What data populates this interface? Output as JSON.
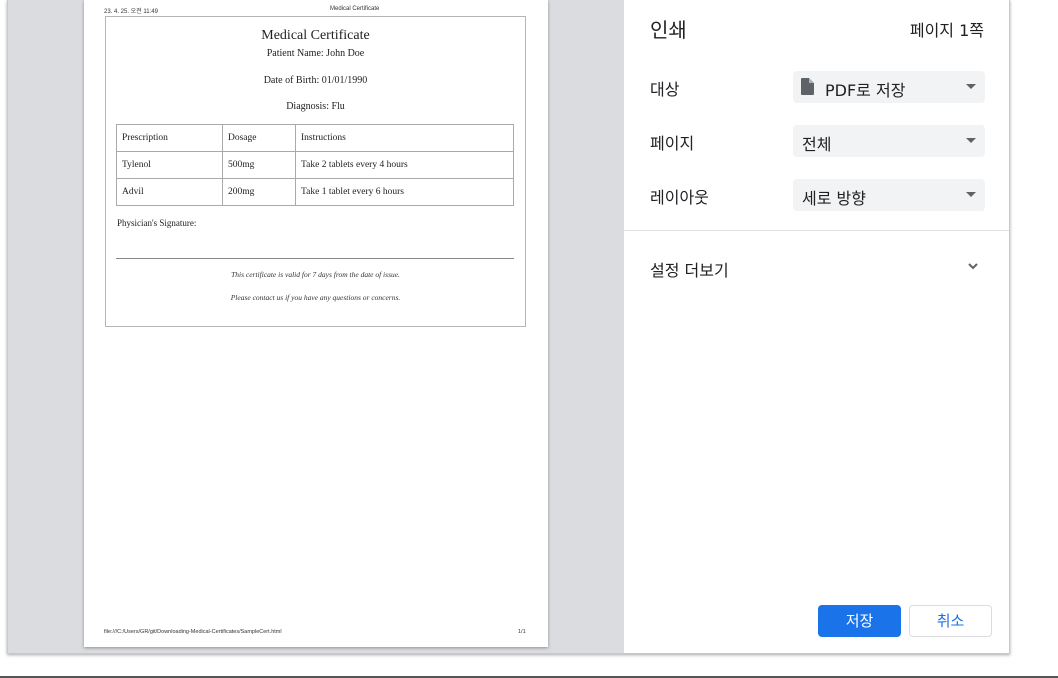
{
  "preview": {
    "header_datetime": "23. 4. 25. 오전 11:49",
    "header_title": "Medical Certificate",
    "certificate": {
      "title": "Medical Certificate",
      "patient": "Patient Name: John Doe",
      "dob": "Date of Birth: 01/01/1990",
      "diagnosis": "Diagnosis: Flu",
      "table": {
        "headers": [
          "Prescription",
          "Dosage",
          "Instructions"
        ],
        "rows": [
          [
            "Tylenol",
            "500mg",
            "Take 2 tablets every 4 hours"
          ],
          [
            "Advil",
            "200mg",
            "Take 1 tablet every 6 hours"
          ]
        ]
      },
      "signature_label": "Physician's Signature:",
      "note1": "This certificate is valid for 7 days from the date of issue.",
      "note2": "Please contact us if you have any questions or concerns."
    },
    "footer_path": "file:///C:/Users/GR/git/Downloading-Medical-Certificates/SampleCert.html",
    "footer_page": "1/1"
  },
  "settings": {
    "title": "인쇄",
    "page_count": "페이지 1쪽",
    "destination": {
      "label": "대상",
      "value": "PDF로 저장",
      "icon": "document-icon"
    },
    "pages": {
      "label": "페이지",
      "value": "전체"
    },
    "layout": {
      "label": "레이아웃",
      "value": "세로 방향"
    },
    "more_settings": "설정 더보기",
    "save_button": "저장",
    "cancel_button": "취소"
  },
  "colors": {
    "accent": "#1a73e8",
    "preview_bg": "#dadce0",
    "select_bg": "#f1f3f4"
  }
}
